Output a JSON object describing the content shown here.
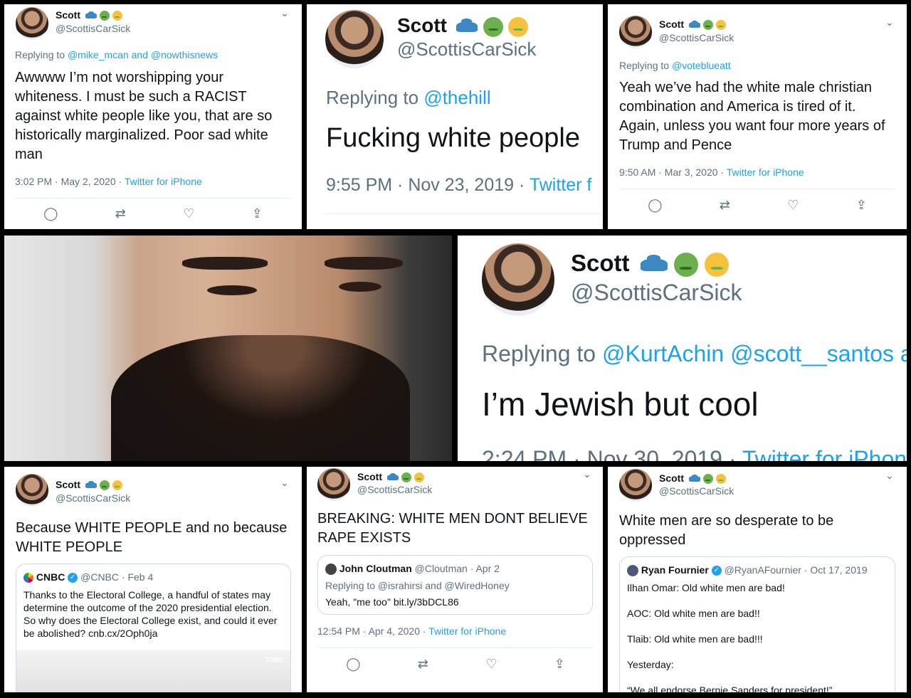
{
  "colors": {
    "link": "#1da1f2",
    "muted": "#5b7083",
    "text": "#0f1419",
    "border": "#000000"
  },
  "icons": {
    "reply": "reply-icon",
    "retweet": "retweet-icon",
    "like": "heart-icon",
    "share": "share-icon",
    "chevron": "chevron-down-icon",
    "verified": "verified-badge-icon"
  },
  "tweet1": {
    "name": "Scott",
    "handle": "@ScottisCarSick",
    "replying": "Replying to",
    "mentions": "@mike_mcan and @nowthisnews",
    "text": "Awwww I’m not worshipping your whiteness. I must be such a RACIST against white people like you, that are so historically marginalized. Poor sad white man",
    "time": "3:02 PM · May 2, 2020 ·",
    "source": "Twitter for iPhone"
  },
  "tweet2": {
    "name": "Scott",
    "handle": "@ScottisCarSick",
    "replying": "Replying to",
    "mentions": "@thehill",
    "text": "Fucking white people",
    "time": "9:55 PM · Nov 23, 2019 ·",
    "source": "Twitter f"
  },
  "tweet3": {
    "name": "Scott",
    "handle": "@ScottisCarSick",
    "replying": "Replying to",
    "mentions": "@voteblueatt",
    "text": "Yeah we’ve had the white male christian combination and America is tired of it. Again, unless you want four more years of Trump and Pence",
    "time": "9:50 AM · Mar 3, 2020 ·",
    "source": "Twitter for iPhone"
  },
  "tweet4": {
    "name": "Scott",
    "handle": "@ScottisCarSick",
    "replying": "Replying to",
    "mentions": "@KurtAchin @scott__santos a",
    "text": "I’m Jewish but cool",
    "time": "2:24 PM · Nov 30, 2019 ·",
    "source": "Twitter for iPhon"
  },
  "tweet5": {
    "name": "Scott",
    "handle": "@ScottisCarSick",
    "text": "Because WHITE PEOPLE and no because WHITE PEOPLE",
    "quote": {
      "name": "CNBC",
      "handle": "@CNBC · Feb 4",
      "text": "Thanks to the Electoral College, a handful of states may determine the outcome of the 2020 presidential election. So why does the Electoral College exist, and could it ever be abolished? cnb.cx/2Oph0ja",
      "media_logo": "CNBC"
    }
  },
  "tweet6": {
    "name": "Scott",
    "handle": "@ScottisCarSick",
    "text": "BREAKING: WHITE MEN DONT BELIEVE RAPE EXISTS",
    "quote": {
      "name": "John Cloutman",
      "handle": "@Cloutman · Apr 2",
      "replying": "Replying to @israhirsi and @WiredHoney",
      "text": "Yeah, \"me too\" bit.ly/3bDCL86"
    },
    "time": "12:54 PM · Apr 4, 2020 ·",
    "source": "Twitter for iPhone"
  },
  "tweet7": {
    "name": "Scott",
    "handle": "@ScottisCarSick",
    "text": "White men are so desperate to be oppressed",
    "quote": {
      "name": "Ryan Fournier",
      "handle": "@RyanAFournier · Oct 17, 2019",
      "line1": "Ilhan Omar: Old white men are bad!",
      "line2": "AOC: Old white men are bad!!",
      "line3": "Tlaib: Old white men are bad!!!",
      "line4": "Yesterday:",
      "line5": "“We all endorse Bernie Sanders for president!”"
    }
  }
}
